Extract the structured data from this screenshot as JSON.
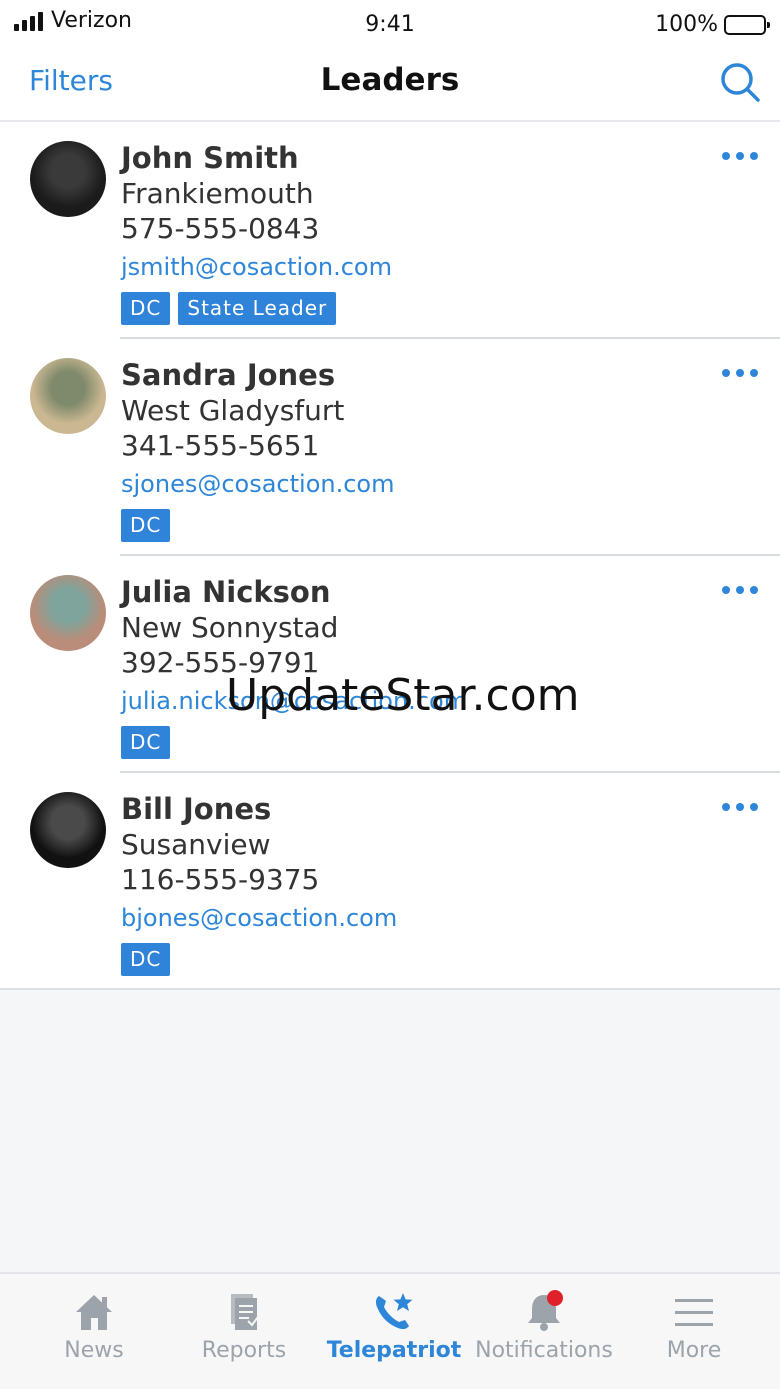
{
  "status_bar": {
    "carrier": "Verizon",
    "time": "9:41",
    "battery": "100%"
  },
  "nav": {
    "filters_label": "Filters",
    "title": "Leaders",
    "search_icon": "search-icon"
  },
  "leaders": [
    {
      "name": "John Smith",
      "city": "Frankiemouth",
      "phone": "575-555-0843",
      "email": "jsmith@cosaction.com",
      "badges": [
        "DC",
        "State Leader"
      ],
      "avatar_colors": [
        "#1b1b1b",
        "#3a3a3a"
      ]
    },
    {
      "name": "Sandra Jones",
      "city": "West Gladysfurt",
      "phone": "341-555-5651",
      "email": "sjones@cosaction.com",
      "badges": [
        "DC"
      ],
      "avatar_colors": [
        "#cbb892",
        "#7f8a6c"
      ]
    },
    {
      "name": "Julia Nickson",
      "city": "New Sonnystad",
      "phone": "392-555-9791",
      "email": "julia.nickson@cosaction.com",
      "badges": [
        "DC"
      ],
      "avatar_colors": [
        "#b98d7a",
        "#7fa49c"
      ]
    },
    {
      "name": "Bill Jones",
      "city": "Susanview",
      "phone": "116-555-9375",
      "email": "bjones@cosaction.com",
      "badges": [
        "DC"
      ],
      "avatar_colors": [
        "#111111",
        "#4a4a4a"
      ]
    }
  ],
  "watermark": "UpdateStar.com",
  "tabs": [
    {
      "label": "News",
      "icon": "house-icon",
      "active": false
    },
    {
      "label": "Reports",
      "icon": "report-icon",
      "active": false
    },
    {
      "label": "Telepatriot",
      "icon": "phone-star-icon",
      "active": true
    },
    {
      "label": "Notifications",
      "icon": "bell-icon",
      "active": false,
      "badge_color": "#e0202a"
    },
    {
      "label": "More",
      "icon": "menu-icon",
      "active": false
    }
  ],
  "colors": {
    "accent": "#2e86d8",
    "badge": "#2f83d8",
    "inactive": "#9da3aa"
  }
}
